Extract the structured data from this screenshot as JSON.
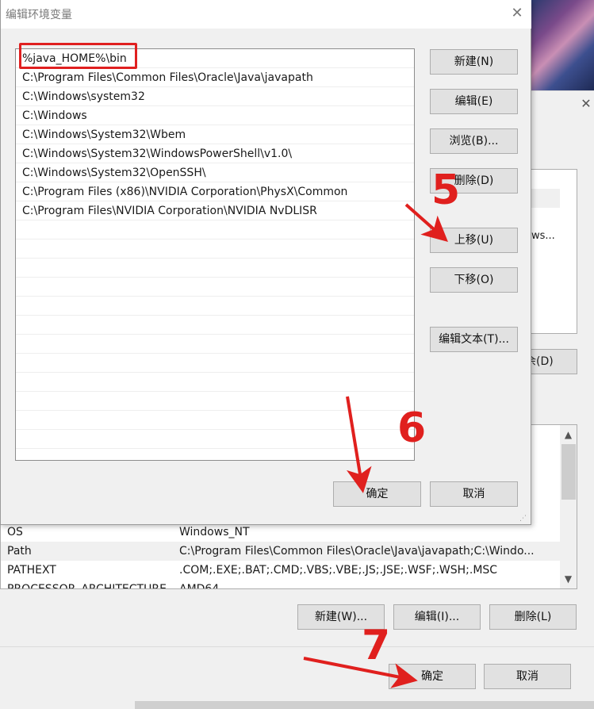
{
  "dialog": {
    "title": "编辑环境变量",
    "close": "✕",
    "paths": [
      "%java_HOME%\\bin",
      "C:\\Program Files\\Common Files\\Oracle\\Java\\javapath",
      "C:\\Windows\\system32",
      "C:\\Windows",
      "C:\\Windows\\System32\\Wbem",
      "C:\\Windows\\System32\\WindowsPowerShell\\v1.0\\",
      "C:\\Windows\\System32\\OpenSSH\\",
      "C:\\Program Files (x86)\\NVIDIA Corporation\\PhysX\\Common",
      "C:\\Program Files\\NVIDIA Corporation\\NVIDIA NvDLISR"
    ],
    "buttons": {
      "new": "新建(N)",
      "edit": "编辑(E)",
      "browse": "浏览(B)...",
      "delete": "删除(D)",
      "move_up": "上移(U)",
      "move_down": "下移(O)",
      "edit_text": "编辑文本(T)...",
      "ok": "确定",
      "cancel": "取消"
    }
  },
  "background_window": {
    "close": "✕",
    "upper_list_partial_text": "ws...",
    "upper_delete_partial": "余(D)",
    "system_variables": [
      {
        "name": "OS",
        "value": "Windows_NT"
      },
      {
        "name": "Path",
        "value": "C:\\Program Files\\Common Files\\Oracle\\Java\\javapath;C:\\Windo..."
      },
      {
        "name": "PATHEXT",
        "value": ".COM;.EXE;.BAT;.CMD;.VBS;.VBE;.JS;.JSE;.WSF;.WSH;.MSC"
      },
      {
        "name": "PROCESSOR_ARCHITECTURE",
        "value": "AMD64"
      }
    ],
    "buttons": {
      "new": "新建(W)...",
      "edit": "编辑(I)...",
      "delete": "删除(L)",
      "ok": "确定",
      "cancel": "取消"
    },
    "scroll_up": "▲",
    "scroll_down": "▼"
  },
  "annotations": {
    "step5": "5",
    "step6": "6",
    "step7": "7",
    "color": "#e0201e"
  }
}
